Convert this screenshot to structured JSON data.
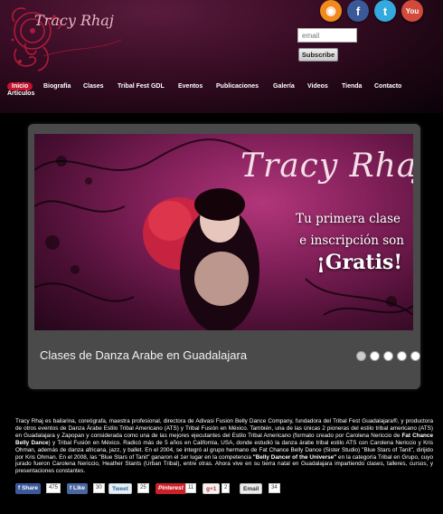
{
  "header": {
    "logo_text": "Tracy Rhaj",
    "social": [
      {
        "icon": "rss-icon",
        "glyph": "◉",
        "color": "#f08a1c"
      },
      {
        "icon": "facebook-icon",
        "glyph": "f",
        "color": "#3b5998"
      },
      {
        "icon": "twitter-icon",
        "glyph": "t",
        "color": "#33a9dd"
      },
      {
        "icon": "youtube-icon",
        "glyph": "You",
        "color": "#d24a3c"
      }
    ],
    "email_placeholder": "email",
    "subscribe_label": "Subscribe"
  },
  "nav": {
    "items": [
      "Inicio",
      "Biografía",
      "Clases",
      "Tribal Fest GDL",
      "Eventos",
      "Publicaciones",
      "Galería",
      "Videos",
      "Tienda",
      "Contacto"
    ],
    "items_row2": [
      "Artículos"
    ],
    "active": "Inicio"
  },
  "slider": {
    "slide_title": "Tracy Rhaj",
    "slide_line1": "Tu primera clase",
    "slide_line2": "e inscripción son",
    "slide_line3": "¡Gratis!",
    "caption": "Clases de Danza Arabe en Guadalajara",
    "dots": 5,
    "active_dot": 1
  },
  "body": {
    "paragraph_parts": [
      "Tracy Rhaj es bailarina, coreógrafa, maestra profesional, directora de Adivasi Fusion Belly Dance Company, fundadora del Tribal Fest Guadalajara®, y productora de otros eventos de Danza Árabe Estilo Tribal Americano (ATS) y Tribal Fusión en México. También, una de las únicas 2 pioneras del estilo tribal americano (ATS) en Guadalajara y Zapopan y considerada como una de las mejores ejecutantes del Estilo Tribal Americano (formato creado por Carolena Nericcio de ",
      "Fat Chance Belly Dance",
      ") y Tribal Fusión en México. Radicó más de 5 años en California, USA, donde estudió la danza árabe tribal estilo ATS con Carolena Nericcio y Kris Ohman, además de danza africana, jazz, y ballet. En el 2004, se integró al grupo hermano de Fat Chance Belly Dance (Sister Studio) \"Blue Stars of Tanit\", dirijido por Kris Ohman. En el 2008, las \"Blue Stars of Tanit\" ganaron el 1er lugar en la competencia ",
      "\"Belly Dancer of the Universe\"",
      " en la categoría Tribal en Grupo, cuyo jurado fueron Carolena Nericcio, Heather Stants (Urban Tribal), entre otras. Ahora vive en su tierra natal en Guadalajara impartiendo clases, talleres, cursos, y presentaciones constantes."
    ]
  },
  "share": {
    "buttons": [
      {
        "label": "f Share",
        "count": "475",
        "bg": "#3b5998",
        "fg": "#ffffff"
      },
      {
        "label": "f Like",
        "count": "30",
        "bg": "#4a66a0",
        "fg": "#ffffff"
      },
      {
        "label": "Tweet",
        "count": "25",
        "bg": "#e9eef3",
        "fg": "#2b6fa6"
      },
      {
        "label": "Pinterest",
        "count": "11",
        "bg": "#cb2027",
        "fg": "#ffffff"
      },
      {
        "label": "g+1",
        "count": "2",
        "bg": "#f4f4f4",
        "fg": "#333333"
      },
      {
        "label": "Email",
        "count": "34",
        "bg": "#ececec",
        "fg": "#333333"
      }
    ]
  },
  "colors": {
    "nav_active": "#c4122f",
    "frame": "#4a4a4a",
    "slide_accent": "#82205a"
  }
}
